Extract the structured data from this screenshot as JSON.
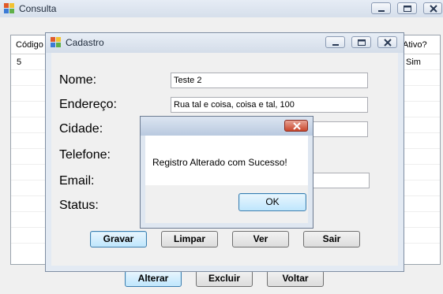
{
  "consulta": {
    "title": "Consulta",
    "grid": {
      "headers": [
        "Código",
        "Ativo?"
      ],
      "row": {
        "codigo": "5",
        "ativo": "Sim"
      }
    },
    "buttons": {
      "alterar": "Alterar",
      "excluir": "Excluir",
      "voltar": "Voltar"
    }
  },
  "cadastro": {
    "title": "Cadastro",
    "labels": {
      "nome": "Nome:",
      "endereco": "Endereço:",
      "cidade": "Cidade:",
      "telefone": "Telefone:",
      "email": "Email:",
      "status": "Status:"
    },
    "values": {
      "nome": "Teste 2",
      "endereco": "Rua tal e coisa, coisa e tal, 100",
      "cidade": "",
      "email": ""
    },
    "buttons": {
      "gravar": "Gravar",
      "limpar": "Limpar",
      "ver": "Ver",
      "sair": "Sair"
    }
  },
  "messagebox": {
    "message": "Registro Alterado com Sucesso!",
    "ok": "OK"
  },
  "icons": {
    "app": "windows-form-icon",
    "minimize": "minimize-icon",
    "maximize": "maximize-icon",
    "close": "close-icon"
  }
}
